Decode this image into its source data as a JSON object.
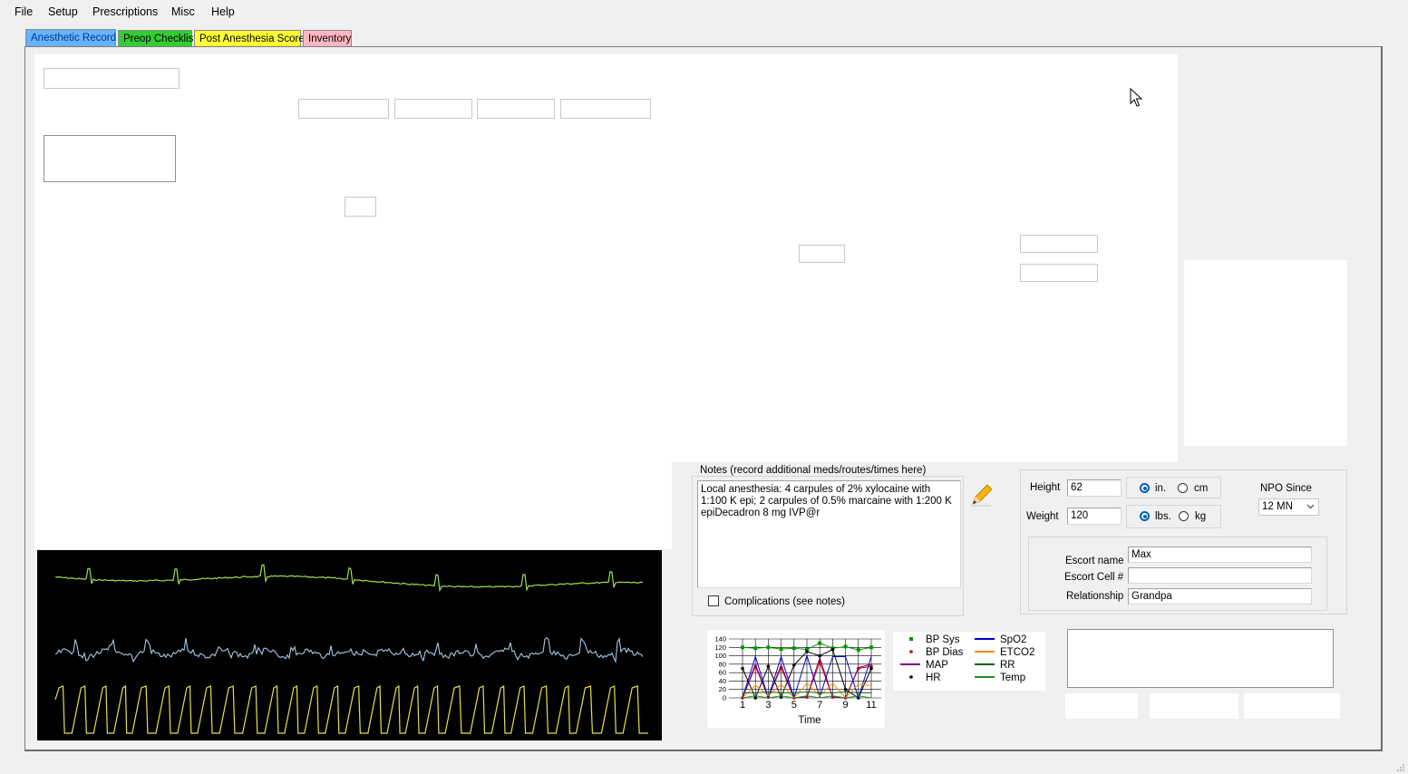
{
  "menu": {
    "file": "File",
    "setup": "Setup",
    "prescriptions": "Prescriptions",
    "misc": "Misc",
    "help": "Help"
  },
  "tabs": [
    {
      "label": "Anesthetic Record",
      "color": "#66b3ff"
    },
    {
      "label": "Preop Checklist",
      "color": "#33cc33"
    },
    {
      "label": "Post Anesthesia Score",
      "color": "#ffff33"
    },
    {
      "label": "Inventory",
      "color": "#ffb6c1"
    }
  ],
  "notes": {
    "legend": "Notes (record additional meds/routes/times here)",
    "text": "Local anesthesia: 4 carpules of 2% xylocaine with 1:100 K epi; 2 carpules of 0.5% marcaine with 1:200 K epiDecadron 8 mg IVP@r",
    "complications_label": "Complications (see notes)"
  },
  "measure": {
    "height_label": "Height",
    "height_value": "62",
    "weight_label": "Weight",
    "weight_value": "120",
    "in_label": "in.",
    "cm_label": "cm",
    "lbs_label": "lbs.",
    "kg_label": "kg"
  },
  "npo": {
    "label": "NPO Since",
    "value": "12 MN"
  },
  "escort": {
    "name_label": "Escort name",
    "name_value": "Max",
    "cell_label": "Escort Cell #",
    "cell_value": "",
    "relationship_label": "Relationship",
    "relationship_value": "Grandpa"
  },
  "chart_data": {
    "type": "line",
    "x": [
      1,
      2,
      3,
      4,
      5,
      6,
      7,
      8,
      9,
      10,
      11
    ],
    "xlabel": "Time",
    "ylim": [
      0,
      140
    ],
    "xticks": [
      "1",
      "3",
      "5",
      "7",
      "9",
      "11"
    ],
    "yticks": [
      "0",
      "20",
      "40",
      "60",
      "80",
      "100",
      "120",
      "140"
    ],
    "series": [
      {
        "name": "BP Sys",
        "color": "#009900",
        "style": "square",
        "values": [
          120,
          118,
          120,
          116,
          118,
          115,
          130,
          118,
          122,
          114,
          120
        ]
      },
      {
        "name": "BP Dias",
        "color": "#cc0000",
        "style": "dot",
        "values": [
          0,
          75,
          2,
          72,
          0,
          2,
          85,
          2,
          0,
          70,
          75
        ]
      },
      {
        "name": "MAP",
        "color": "#800080",
        "style": "line",
        "values": [
          0,
          80,
          0,
          78,
          0,
          2,
          95,
          2,
          0,
          72,
          80
        ]
      },
      {
        "name": "HR",
        "color": "#000000",
        "style": "dot",
        "values": [
          70,
          0,
          75,
          2,
          78,
          110,
          100,
          115,
          20,
          0,
          70
        ]
      },
      {
        "name": "SpO2",
        "color": "#0000cc",
        "style": "line",
        "values": [
          0,
          98,
          0,
          98,
          0,
          100,
          2,
          98,
          98,
          0,
          98
        ]
      },
      {
        "name": "ETCO2",
        "color": "#ff8c00",
        "style": "line",
        "values": [
          0,
          30,
          5,
          32,
          0,
          35,
          5,
          35,
          0,
          32,
          30
        ]
      },
      {
        "name": "RR",
        "color": "#006400",
        "style": "line",
        "values": [
          12,
          12,
          14,
          12,
          12,
          14,
          12,
          12,
          14,
          12,
          12
        ]
      },
      {
        "name": "Temp",
        "color": "#228b22",
        "style": "line",
        "values": [
          0,
          5,
          0,
          5,
          0,
          5,
          0,
          5,
          0,
          5,
          0
        ]
      }
    ]
  },
  "monitor": {
    "wave_colors": [
      "#9ee04a",
      "#a6c8e6",
      "#e6e04a"
    ]
  }
}
